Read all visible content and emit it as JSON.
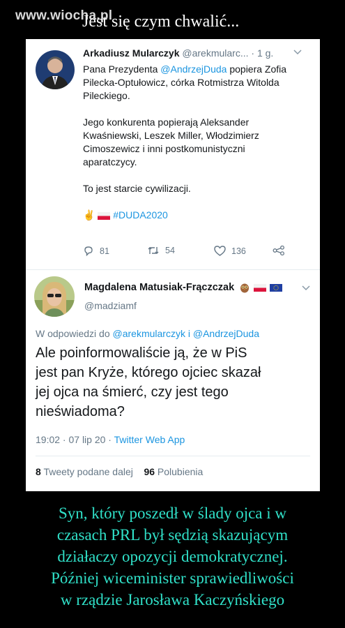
{
  "watermark": "www.wiocha.pl",
  "top_title": "Jest się czym chwalić...",
  "tweet1": {
    "author": "Arkadiusz Mularczyk",
    "handle": "@arekmularc...",
    "time": "· 1 g.",
    "line1_pre": "Pana Prezydenta ",
    "line1_mention": "@AndrzejDuda",
    "line1_post": " popiera Zofia",
    "line2": "Pilecka-Optułowicz, córka Rotmistrza Witolda",
    "line3": "Pileckiego.",
    "para2_l1": "Jego konkurenta popierają  Aleksander",
    "para2_l2": "Kwaśniewski, Leszek Miller, Włodzimierz",
    "para2_l3": "Cimoszewicz i inni postkomunistyczni",
    "para2_l4": "aparatczycy.",
    "para3": "To jest starcie cywilizacji.",
    "emoji": "✌️",
    "hashtag": "#DUDA2020",
    "replies": "81",
    "retweets": "54",
    "likes": "136"
  },
  "tweet2": {
    "author": "Magdalena Matusiak-Frączczak",
    "handle": "@madziamf",
    "reply_prefix": "W odpowiedzi do ",
    "reply_mentions": "@arekmularczyk i @AndrzejDuda",
    "text_l1": "Ale poinformowaliście ją, że w PiS",
    "text_l2": "jest pan Kryże, którego ojciec skazał",
    "text_l3": "jej ojca na śmierć, czy jest tego",
    "text_l4": "nieświadoma?",
    "timestamp": "19:02 · 07 lip 20 · ",
    "source": "Twitter Web App",
    "retweet_count": "8",
    "retweet_label": "Tweety podane dalej",
    "like_count": "96",
    "like_label": "Polubienia"
  },
  "caption": [
    "Syn, który poszedł w ślady ojca i w",
    "czasach PRL był sędzią skazującym",
    "działaczy opozycji demokratycznej.",
    "Później wiceminister sprawiedliwości",
    "w rządzie Jarosława Kaczyńskiego"
  ],
  "colors": {
    "link": "#1b95e0",
    "caption": "#30e0c8",
    "muted": "#657786"
  },
  "icons": [
    "reply-icon",
    "retweet-icon",
    "like-icon",
    "share-icon",
    "chevron-down-icon",
    "owl-emoji-icon",
    "poland-flag-icon",
    "eu-flag-icon"
  ]
}
